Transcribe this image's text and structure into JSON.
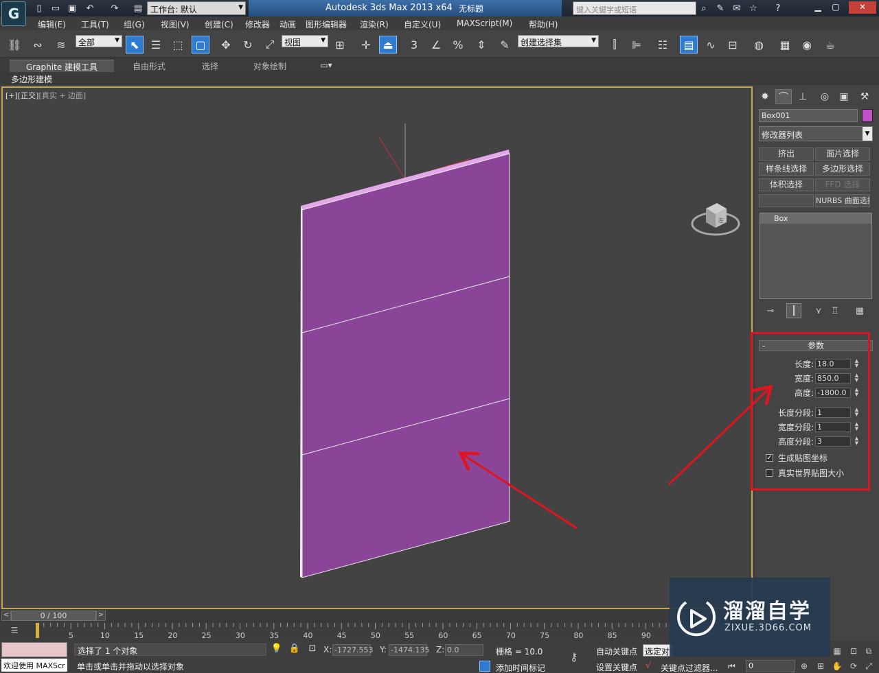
{
  "titlebar": {
    "workspace_label": "工作台: 默认",
    "app_title": "Autodesk 3ds Max  2013 x64",
    "document_title": "无标题",
    "search_placeholder": "键入关键字或短语"
  },
  "menubar": {
    "items": [
      "编辑(E)",
      "工具(T)",
      "组(G)",
      "视图(V)",
      "创建(C)",
      "修改器",
      "动画",
      "图形编辑器",
      "渲染(R)",
      "自定义(U)",
      "MAXScript(M)",
      "帮助(H)"
    ]
  },
  "toolbar": {
    "selection_filter": "全部",
    "reference_coord": "视图",
    "named_selection_set": "创建选择集",
    "snap_3": "3",
    "angle_snap_pct": "%"
  },
  "ribbon": {
    "tabs": [
      "Graphite 建模工具",
      "自由形式",
      "选择",
      "对象绘制"
    ],
    "active_tab": "Graphite 建模工具",
    "sub_panel": "多边形建模"
  },
  "viewport": {
    "label_plus": "[+]",
    "label_view": "[正交]",
    "label_shading": "[真实 + 边面]",
    "object_color": "#8b4598",
    "viewcube_face": "左"
  },
  "command_panel": {
    "object_name": "Box001",
    "object_color": "#c050c8",
    "modifier_list": "修改器列表",
    "modifier_buttons": [
      "挤出",
      "面片选择",
      "样条线选择",
      "多边形选择",
      "体积选择",
      "FFD 选择",
      "",
      "NURBS 曲面选择"
    ],
    "stack_item": "Box",
    "params": {
      "header": "参数",
      "length_label": "长度:",
      "length_value": "18.0",
      "width_label": "宽度:",
      "width_value": "850.0",
      "height_label": "高度:",
      "height_value": "-1800.0",
      "length_segs_label": "长度分段:",
      "length_segs_value": "1",
      "width_segs_label": "宽度分段:",
      "width_segs_value": "1",
      "height_segs_label": "高度分段:",
      "height_segs_value": "3",
      "gen_mapping_label": "生成贴图坐标",
      "gen_mapping_checked": true,
      "real_world_label": "真实世界贴图大小",
      "real_world_checked": false
    },
    "highlight_color": "#e0141e"
  },
  "timeline": {
    "frame_display": "0 / 100",
    "current_frame": 0,
    "total_frames": 100,
    "tick_labels": [
      "0",
      "5",
      "10",
      "15",
      "20",
      "25",
      "30",
      "35",
      "40",
      "45",
      "50",
      "55",
      "60",
      "65",
      "70",
      "75",
      "80",
      "85",
      "90"
    ]
  },
  "statusbar": {
    "maxscript_welcome": "欢迎使用 MAXScr",
    "selection_status": "选择了 1 个对象",
    "prompt": "单击或单击并拖动以选择对象",
    "x_label": "X:",
    "x_value": "-1727.553",
    "y_label": "Y:",
    "y_value": "-1474.135",
    "z_label": "Z:",
    "z_value": "0.0",
    "grid": "栅格 = 10.0",
    "add_time_tag": "添加时间标记",
    "auto_key": "自动关键点",
    "set_key": "设置关键点",
    "selection_set_value": "选定对象",
    "key_filters": "关键点过滤器...",
    "frame_value": "0"
  },
  "watermark": {
    "title": "溜溜自学",
    "subtitle": "ZIXUE.3D66.COM"
  }
}
